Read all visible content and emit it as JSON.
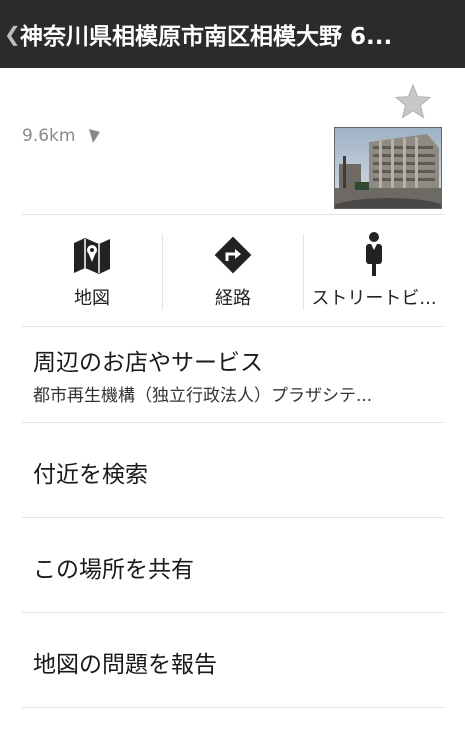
{
  "header": {
    "back_icon": "chevron-left-icon",
    "title": "神奈川県相模原市南区相模大野 6..."
  },
  "place": {
    "favorite_icon": "star-icon",
    "distance": "9.6km",
    "direction_icon": "navigation-arrow-icon",
    "thumbnail": "street-view-thumbnail"
  },
  "actions": [
    {
      "label": "地図",
      "icon": "map-icon"
    },
    {
      "label": "経路",
      "icon": "directions-icon"
    },
    {
      "label": "ストリートビ...",
      "icon": "pegman-icon"
    }
  ],
  "nearby": {
    "title": "周辺のお店やサービス",
    "subtitle": "都市再生機構（独立行政法人）プラザシテ..."
  },
  "menu": {
    "search_nearby": "付近を検索",
    "share": "この場所を共有",
    "report": "地図の問題を報告"
  },
  "colors": {
    "header_bg": "#2b2b2b",
    "divider": "#e2e2e2",
    "star": "#c8c8c8"
  }
}
